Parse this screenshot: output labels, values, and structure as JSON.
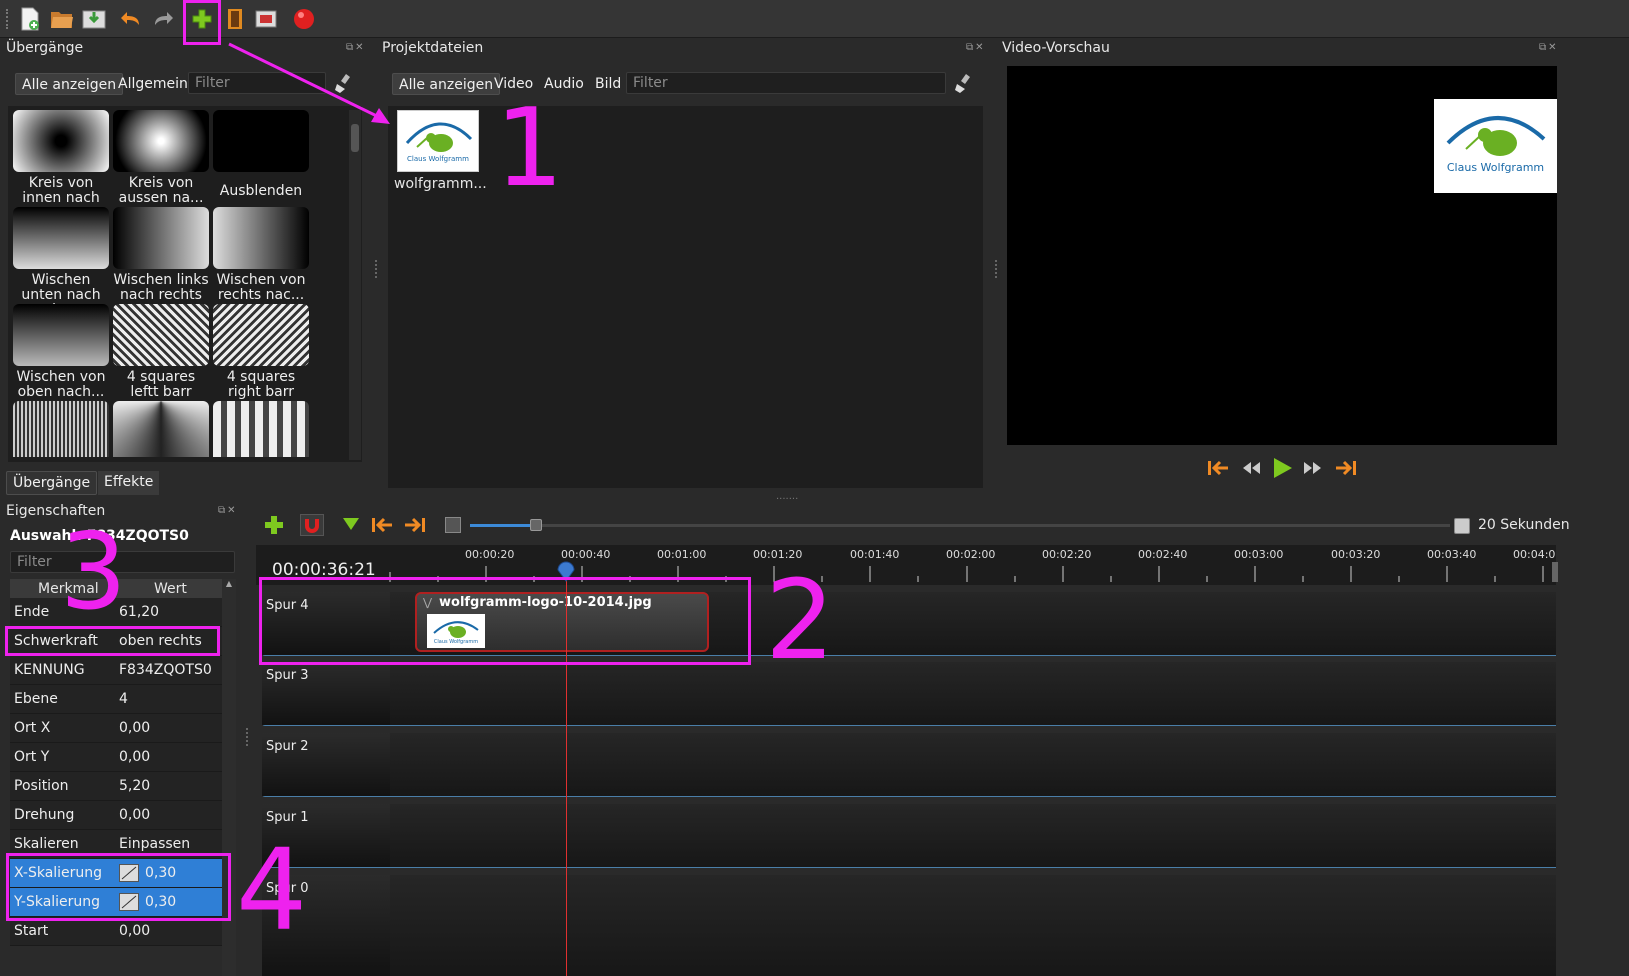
{
  "toolbar": {
    "icons": [
      "new-file-icon",
      "open-folder-icon",
      "save-icon",
      "undo-icon",
      "redo-icon",
      "import-files-icon",
      "profile-icon",
      "fullscreen-icon",
      "record-icon"
    ]
  },
  "transitions_panel": {
    "title": "Übergänge",
    "tabs": [
      "Alle anzeigen",
      "Allgemein"
    ],
    "filter_placeholder": "Filter",
    "items": [
      {
        "label": "Kreis von innen nach aussen"
      },
      {
        "label": "Kreis von aussen na..."
      },
      {
        "label": "Ausblenden"
      },
      {
        "label": "Wischen unten nach oben"
      },
      {
        "label": "Wischen links nach rechts"
      },
      {
        "label": "Wischen von rechts nac..."
      },
      {
        "label": "Wischen von oben nach..."
      },
      {
        "label": "4 squares leftt barr"
      },
      {
        "label": "4 squares right barr"
      },
      {
        "label": ""
      },
      {
        "label": ""
      },
      {
        "label": ""
      }
    ],
    "bottom_tabs": [
      "Übergänge",
      "Effekte"
    ]
  },
  "project_files": {
    "title": "Projektdateien",
    "tabs": [
      "Alle anzeigen",
      "Video",
      "Audio",
      "Bild"
    ],
    "filter_placeholder": "Filter",
    "files": [
      {
        "name": "wolfgramm...",
        "logo_text": "Claus Wolfgramm"
      }
    ]
  },
  "video_preview": {
    "title": "Video-Vorschau",
    "logo_text": "Claus Wolfgramm"
  },
  "properties": {
    "title": "Eigenschaften",
    "selection": "Auswahl: F834ZQOTS0",
    "filter_placeholder": "Filter",
    "col_key": "Merkmal",
    "col_value": "Wert",
    "rows": [
      {
        "key": "Ende",
        "value": "61,20"
      },
      {
        "key": "Schwerkraft",
        "value": "oben rechts"
      },
      {
        "key": "KENNUNG",
        "value": "F834ZQOTS0"
      },
      {
        "key": "Ebene",
        "value": "4"
      },
      {
        "key": "Ort X",
        "value": "0,00"
      },
      {
        "key": "Ort Y",
        "value": "0,00"
      },
      {
        "key": "Position",
        "value": "5,20"
      },
      {
        "key": "Drehung",
        "value": "0,00"
      },
      {
        "key": "Skalieren",
        "value": "Einpassen"
      },
      {
        "key": "X-Skalierung",
        "value": "0,30"
      },
      {
        "key": "Y-Skalierung",
        "value": "0,30"
      },
      {
        "key": "Start",
        "value": "0,00"
      }
    ]
  },
  "timeline": {
    "zoom_label": "20 Sekunden",
    "timecode": "00:00:36:21",
    "ruler": [
      "00:00:20",
      "00:00:40",
      "00:01:00",
      "00:01:20",
      "00:01:40",
      "00:02:00",
      "00:02:20",
      "00:02:40",
      "00:03:00",
      "00:03:20",
      "00:03:40",
      "00:04:0"
    ],
    "tracks": [
      "Spur 4",
      "Spur 3",
      "Spur 2",
      "Spur 1",
      "Spur 0"
    ],
    "clip": {
      "name": "wolfgramm-logo-10-2014.jpg",
      "logo_text": "Claus Wolfgramm"
    }
  },
  "annotations": [
    "1",
    "2",
    "3",
    "4"
  ],
  "colors": {
    "magenta": "#ee22ee",
    "selection_blue": "#2f7fd6",
    "playhead": "#e03030"
  }
}
